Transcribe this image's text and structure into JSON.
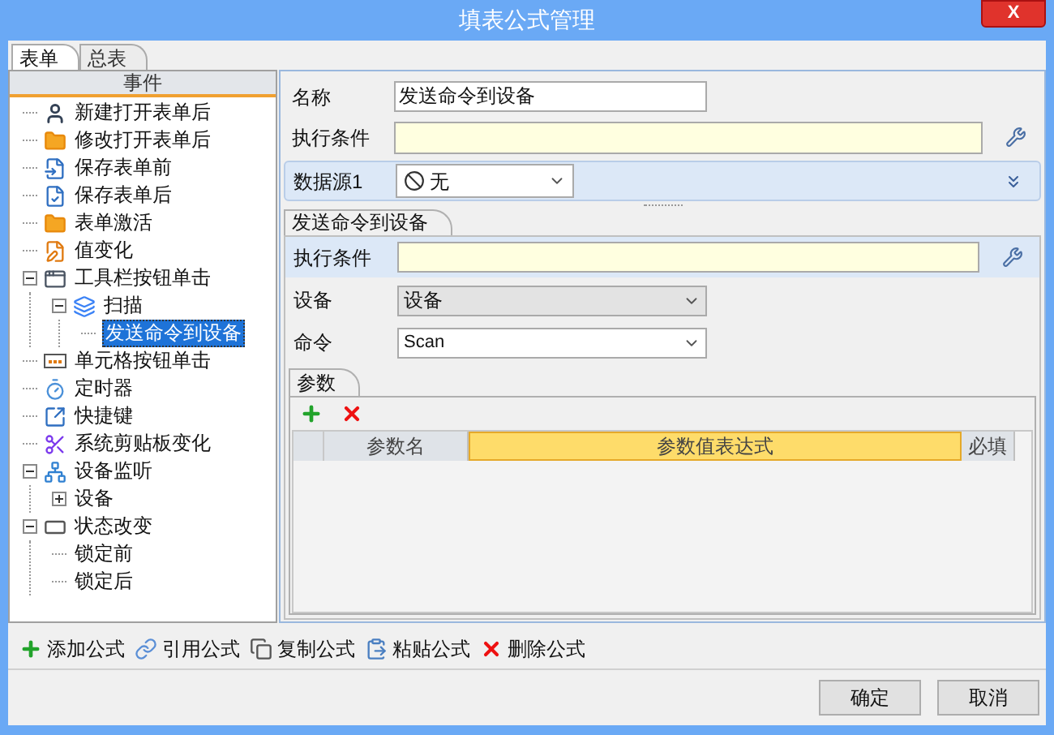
{
  "window": {
    "title": "填表公式管理",
    "close": "X"
  },
  "tabs": [
    {
      "label": "表单",
      "selected": true
    },
    {
      "label": "总表",
      "selected": false
    }
  ],
  "tree": {
    "header": "事件",
    "items": [
      {
        "label": "新建打开表单后",
        "kind": "person",
        "selected": false
      },
      {
        "label": "修改打开表单后",
        "kind": "folder",
        "selected": false
      },
      {
        "label": "保存表单前",
        "kind": "save-before",
        "selected": false
      },
      {
        "label": "保存表单后",
        "kind": "save-after",
        "selected": false
      },
      {
        "label": "表单激活",
        "kind": "folder",
        "selected": false
      },
      {
        "label": "值变化",
        "kind": "edit",
        "selected": false
      },
      {
        "label": "工具栏按钮单击",
        "kind": "toolbar",
        "selected": false,
        "expanded": true,
        "children": [
          {
            "label": "扫描",
            "kind": "scan",
            "selected": false,
            "expanded": true,
            "children": [
              {
                "label": "发送命令到设备",
                "selected": true
              }
            ]
          }
        ]
      },
      {
        "label": "单元格按钮单击",
        "kind": "cell",
        "selected": false
      },
      {
        "label": "定时器",
        "kind": "timer",
        "selected": false
      },
      {
        "label": "快捷键",
        "kind": "shortcut",
        "selected": false
      },
      {
        "label": "系统剪贴板变化",
        "kind": "scissors",
        "selected": false
      },
      {
        "label": "设备监听",
        "kind": "device",
        "selected": false,
        "expanded": true,
        "children": [
          {
            "label": "设备",
            "selected": false,
            "expanded": false
          }
        ]
      },
      {
        "label": "状态改变",
        "kind": "state",
        "selected": false,
        "expanded": true,
        "children": [
          {
            "label": "锁定前",
            "selected": false
          },
          {
            "label": "锁定后",
            "selected": false
          }
        ]
      }
    ]
  },
  "form": {
    "name_label": "名称",
    "name_value": "发送命令到设备",
    "condition_label": "执行条件"
  },
  "datasource": {
    "label": "数据源1",
    "value": "无"
  },
  "action_tab": {
    "label": "发送命令到设备"
  },
  "action": {
    "condition_label": "执行条件",
    "device_label": "设备",
    "device_value": "设备",
    "device_disabled": true,
    "command_label": "命令",
    "command_value": "Scan",
    "command_disabled": false
  },
  "params": {
    "tab": "参数",
    "columns": [
      {
        "label": "参数名",
        "selected": false
      },
      {
        "label": "参数值表达式",
        "selected": true
      },
      {
        "label": "必填",
        "selected": false
      }
    ]
  },
  "toolbar": [
    {
      "label": "添加公式",
      "kind": "add"
    },
    {
      "label": "引用公式",
      "kind": "link"
    },
    {
      "label": "复制公式",
      "kind": "copy"
    },
    {
      "label": "粘贴公式",
      "kind": "paste"
    },
    {
      "label": "删除公式",
      "kind": "delete"
    }
  ],
  "buttons": [
    "确定",
    "取消"
  ]
}
